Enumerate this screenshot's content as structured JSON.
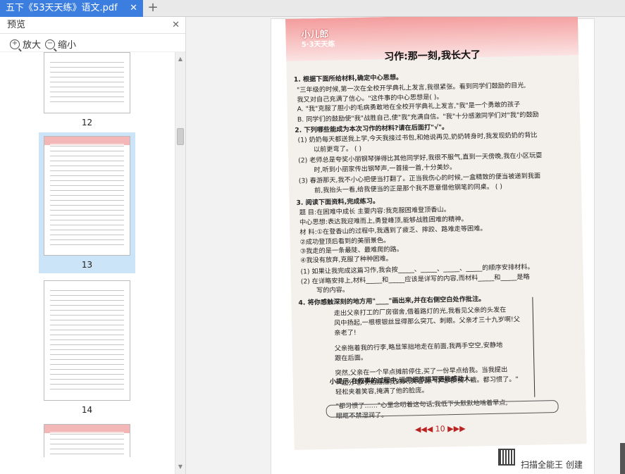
{
  "tab": {
    "title": "五下《53天天练》语文.pdf"
  },
  "sidebar": {
    "title": "预览",
    "zoom_in": "放大",
    "zoom_out": "缩小",
    "pages": [
      {
        "label": "12"
      },
      {
        "label": "13"
      },
      {
        "label": "14"
      }
    ]
  },
  "doc": {
    "logo": "小儿郎",
    "logo_sub": "5·3天天练",
    "title": "习作:那一刻,我长大了",
    "lines": [
      {
        "t": "1. 根据下面所给材料,确定中心思想。",
        "b": true
      },
      {
        "t": "\"三年级的时候,第一次在全校开学典礼上发言,我很紧张。看到同学们鼓励的目光,"
      },
      {
        "t": "我又对自己充满了信心。\"这件事的中心思想是(    )。"
      },
      {
        "t": "A. \"我\"克服了胆小的毛病勇敢地在全校开学典礼上发言,\"我\"是一个勇敢的孩子"
      },
      {
        "t": "B. 同学们的鼓励使\"我\"战胜自己,使\"我\"充满自信。\"我\"十分感激同学们对\"我\"的鼓励"
      },
      {
        "t": "2. 下列哪些能成为本次习作的材料?请在后面打\"√\"。",
        "b": true
      },
      {
        "t": "(1) 奶奶每天都送我上学,今天我接过书包,和她说再见,奶奶转身时,我发现奶奶的背比"
      },
      {
        "t": "以前更弯了。                                                             (    )"
      },
      {
        "t": "(2) 老师总是夸奖小丽钢琴弹得比其他同学好,我很不服气,直到一天傍晚,我在小区玩耍"
      },
      {
        "t": "时,听到小丽家传出钢琴声,一首接一首,十分美妙。"
      },
      {
        "t": "(3) 春游那天,我不小心把便当打翻了。正当我伤心的时候,一盒精致的便当被递到我面"
      },
      {
        "t": "前,我抬头一看,给我便当的正是那个我不愿意借他钢笔的同桌。                   (    )"
      },
      {
        "t": "3. 阅读下面资料,完成练习。",
        "b": true
      },
      {
        "t": "题      目:在困难中成长              主要内容:我克服困难登顶香山。"
      },
      {
        "t": "中心思想:表达我迎难而上,勇登峰顶,能够战胜困难的精神。"
      },
      {
        "t": "材      料:①在登香山的过程中,我遇到了疲乏、摔跤、路难走等困难。"
      },
      {
        "t": "                ②成功登顶后看到的美丽景色。"
      },
      {
        "t": "                ③我走的是一条最陡、最难爬的路。"
      },
      {
        "t": "                ④我没有放弃,克服了种种困难。"
      },
      {
        "t": "(1) 如果让我完成这篇习作,我会按_____、_____、_____、_____的顺序安排材料。"
      },
      {
        "t": "(2) 在详略安排上,材料_____和_____应该是详写的内容,而材料_____和_____是略"
      },
      {
        "t": "写的内容。"
      },
      {
        "t": "4. 将你感触深刻的地方用\"____\"画出来,并在右侧空白处作批注。",
        "b": true
      },
      {
        "t": "走出父亲打工的厂房宿舍,借着路灯的光,我看见父亲的头发在"
      },
      {
        "t": "风中扬起,一根根银丝显得那么突兀、刺眼。父亲才三十九岁啊!父"
      },
      {
        "t": "亲老了!"
      },
      {
        "t": "父亲拖着我的行李,略显笨拙地走在前面,我两手空空,安静地"
      },
      {
        "t": "跟在后面。"
      },
      {
        "t": "突然,父亲在一个早点摊前停住,买了一份早点给我。当我提出"
      },
      {
        "t": "一起分吃时,他摇摇我的头,笑着说:\"你吃吧!我不饿。都习惯了。\""
      },
      {
        "t": "轻松夹着笑容,掩满了他的脸庞。"
      },
      {
        "t": "\"都习惯了……\"心里念叨着这句话,我低下头默默地啃着早点,"
      },
      {
        "t": "眼眶不禁湿润了。"
      },
      {
        "t": "小提示   在叙事的过程中,运用细节描写更能感动人。",
        "b": true
      }
    ],
    "page_number": "◀◀◀  10  ▶▶▶",
    "scanner_text": "扫描全能王 创建"
  }
}
